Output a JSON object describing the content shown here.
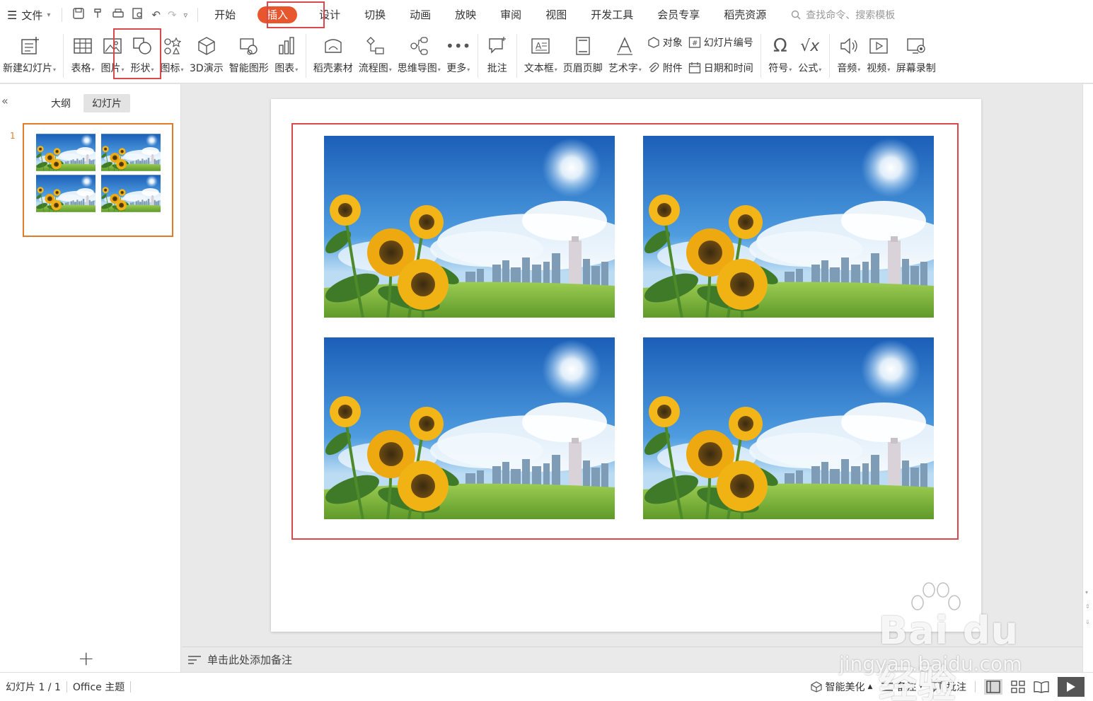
{
  "menubar": {
    "file_label": "文件",
    "tabs": [
      {
        "label": "开始"
      },
      {
        "label": "插入"
      },
      {
        "label": "设计"
      },
      {
        "label": "切换"
      },
      {
        "label": "动画"
      },
      {
        "label": "放映"
      },
      {
        "label": "审阅"
      },
      {
        "label": "视图"
      },
      {
        "label": "开发工具"
      },
      {
        "label": "会员专享"
      },
      {
        "label": "稻壳资源"
      }
    ],
    "active_tab": "插入",
    "search_placeholder": "查找命令、搜索模板"
  },
  "ribbon": {
    "new_slide": "新建幻灯片",
    "table": "表格",
    "picture": "图片",
    "shape": "形状",
    "icon": "图标",
    "demo3d": "3D演示",
    "smart_graphic": "智能图形",
    "chart": "图表",
    "docer_material": "稻壳素材",
    "flowchart": "流程图",
    "mindmap": "思维导图",
    "more": "更多",
    "comment": "批注",
    "textbox": "文本框",
    "header_footer": "页眉页脚",
    "wordart": "艺术字",
    "object": "对象",
    "attachment": "附件",
    "slide_number": "幻灯片编号",
    "datetime": "日期和时间",
    "symbol": "符号",
    "formula": "公式",
    "audio": "音频",
    "video": "视频",
    "screen_record": "屏幕录制"
  },
  "left_panel": {
    "tab_outline": "大纲",
    "tab_slides": "幻灯片",
    "active_tab": "幻灯片",
    "slide_number": "1",
    "add_symbol": "+"
  },
  "notes": {
    "placeholder": "单击此处添加备注"
  },
  "statusbar": {
    "slide_info": "幻灯片 1 / 1",
    "theme": "Office 主题",
    "smart_beautify": "智能美化",
    "notes": "备注",
    "comment": "批注"
  },
  "watermark": {
    "brand": "Bai du 经验",
    "url": "jingyan.baidu.com"
  },
  "colors": {
    "accent": "#e8562e",
    "highlight_border": "#d9484b",
    "thumb_border": "#e07b2a"
  }
}
